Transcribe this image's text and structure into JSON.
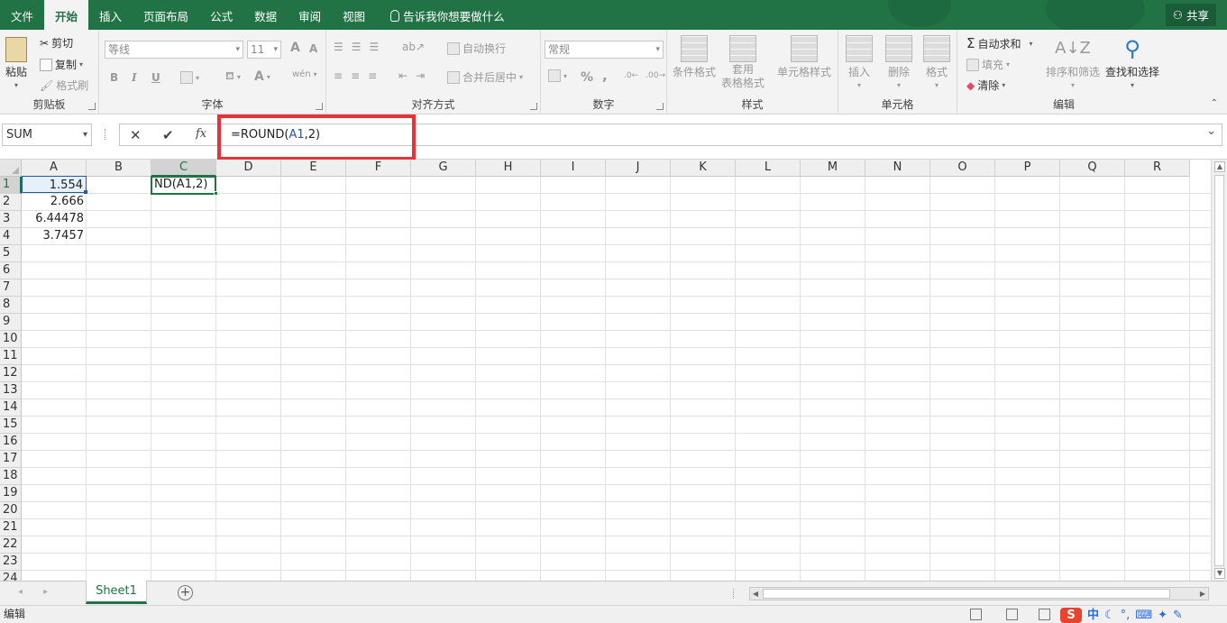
{
  "tabs": [
    "文件",
    "开始",
    "插入",
    "页面布局",
    "公式",
    "数据",
    "审阅",
    "视图"
  ],
  "active_tab": "开始",
  "tell_me": "告诉我你想要做什么",
  "share": "共享",
  "clipboard": {
    "paste": "粘贴",
    "cut": "剪切",
    "copy": "复制",
    "format_painter": "格式刷",
    "label": "剪贴板"
  },
  "font": {
    "name": "等线",
    "size": "11",
    "bold": "B",
    "italic": "I",
    "underline": "U",
    "grow": "A",
    "shrink": "A",
    "label": "字体"
  },
  "alignment": {
    "wrap": "自动换行",
    "merge": "合并后居中",
    "label": "对齐方式"
  },
  "number": {
    "format": "常规",
    "percent": "%",
    "comma": ",",
    "label": "数字"
  },
  "styles": {
    "conditional": "条件格式",
    "table1": "套用",
    "table2": "表格格式",
    "cell_styles": "单元格样式",
    "label": "样式"
  },
  "cells": {
    "insert": "插入",
    "delete": "删除",
    "format": "格式",
    "label": "单元格"
  },
  "editing": {
    "autosum": "自动求和",
    "fill": "填充",
    "clear": "清除",
    "sort": "排序和筛选",
    "find": "查找和选择",
    "label": "编辑"
  },
  "formula_bar": {
    "name_box": "SUM",
    "formula_prefix": "=ROUND(",
    "formula_ref": "A1",
    "formula_suffix": ",2)"
  },
  "columns": [
    "A",
    "B",
    "C",
    "D",
    "E",
    "F",
    "G",
    "H",
    "I",
    "J",
    "K",
    "L",
    "M",
    "N",
    "O",
    "P",
    "Q",
    "R"
  ],
  "rows": [
    "1",
    "2",
    "3",
    "4",
    "5",
    "6",
    "7",
    "8",
    "9",
    "10",
    "11",
    "12",
    "13",
    "14",
    "15",
    "16",
    "17",
    "18",
    "19",
    "20",
    "21",
    "22",
    "23",
    "24"
  ],
  "cells_data": {
    "A1": "1.554",
    "A2": "2.666",
    "A3": "6.44478",
    "A4": "3.7457",
    "C1": "ND(A1,2)"
  },
  "sheet_tab": "Sheet1",
  "add_sheet": "+",
  "status": "编辑",
  "ime": {
    "sogou": "S",
    "lang": "中"
  }
}
